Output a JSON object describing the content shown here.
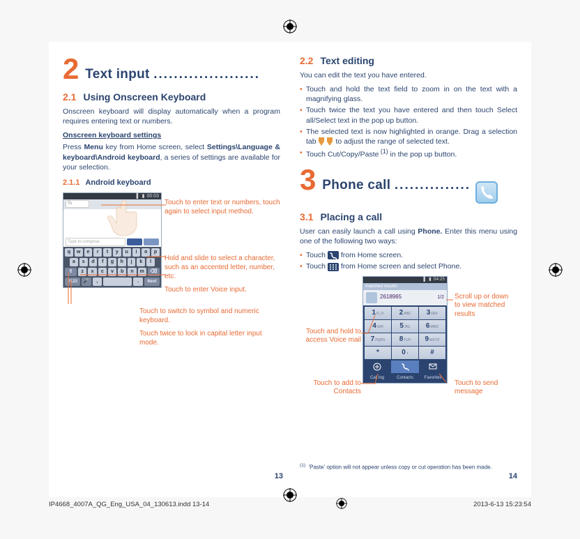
{
  "left": {
    "chapter_num": "2",
    "chapter_title": "Text input",
    "chapter_dots": ".....................",
    "h21_num": "2.1",
    "h21_txt": "Using Onscreen Keyboard",
    "p1": "Onscreen keyboard will display automatically when a program requires entering text or numbers.",
    "kbset_hdr": "Onscreen keyboard settings",
    "p2a": "Press ",
    "p2_menu": "Menu",
    "p2b": " key from Home screen, select ",
    "p2_set": "Settings\\Language & keyboard\\Android keyboard",
    "p2c": ", a series of settings are available for your selection.",
    "h211_num": "2.1.1",
    "h211_txt": "Android keyboard",
    "kb": {
      "time": "00:03",
      "to": "To",
      "compose": "Type to compose",
      "row1": [
        "q",
        "w",
        "e",
        "r",
        "t",
        "y",
        "u",
        "i",
        "o",
        "p"
      ],
      "row2": [
        "a",
        "s",
        "d",
        "f",
        "g",
        "h",
        "j",
        "k",
        "l"
      ],
      "row3_shift": "⇧",
      "row3": [
        "z",
        "x",
        "c",
        "v",
        "b",
        "n",
        "m"
      ],
      "row3_del": "⌫",
      "row4": [
        "?123",
        "🎤",
        ",",
        "space",
        ".",
        "Next"
      ],
      "callout1": "Touch to enter text or numbers, touch again to select input method.",
      "callout2": "Hold and slide to select a character, such as an accented letter, number, etc.",
      "callout3": "Touch to enter Voice input.",
      "callout4": "Touch to switch to symbol and numeric keyboard.",
      "callout5": "Touch twice to lock in capital letter input mode."
    },
    "pg": "13"
  },
  "right": {
    "h22_num": "2.2",
    "h22_txt": "Text editing",
    "p1": "You can edit the text you have entered.",
    "b1": "Touch and hold the text field to zoom in on the text with a magnifying glass.",
    "b2a": "Touch twice the text you have entered and then touch ",
    "b2_bold": "Select all/Select text",
    "b2b": " in the pop up button.",
    "b3a": "The selected text is now highlighted in orange. Drag a selection tab ",
    "b3b": " to adjust the range of selected text.",
    "b4a": "Touch ",
    "b4_bold": "Cut/Copy/Paste",
    "b4_sup": " (1)",
    "b4b": " in the pop up button.",
    "chapter_num": "3",
    "chapter_title": "Phone call",
    "chapter_dots": "...............",
    "h31_num": "3.1",
    "h31_txt": "Placing a call",
    "p2a": "User can easily launch a call using ",
    "p2_phone": "Phone.",
    "p2b": " Enter this menu using one of the following two ways:",
    "pb1a": "Touch ",
    "pb1b": " from Home screen.",
    "pb2a": "Touch ",
    "pb2b": " from Home screen and select ",
    "pb2_phone": "Phone.",
    "dialer": {
      "time": "04:25",
      "tabtitle": "matched results",
      "num_display": "2618965",
      "mini": "1/2",
      "keys": [
        [
          "1",
          "2 ABC",
          "3 DEF"
        ],
        [
          "4 GHI",
          "5 JKL",
          "6 MNO"
        ],
        [
          "7 PQRS",
          "8 TUV",
          "9 WXYZ"
        ],
        [
          "*",
          "0 +",
          "#"
        ]
      ],
      "tabs": [
        "Call log",
        "Contacts",
        "Favorites"
      ],
      "c_right1": "Scroll up or down to view matched results",
      "c_left1": "Touch and hold to access Voice mail",
      "c_left2": "Touch to add to Contacts",
      "c_right2": "Touch to send message"
    },
    "footnote_sup": "(1)",
    "footnote_txt": "'Paste' option will not appear unless copy or cut operation has been made.",
    "pg": "14"
  },
  "footer": {
    "left": "IP4668_4007A_QG_Eng_USA_04_130613.indd   13-14",
    "right": "2013-6-13   15:23:54"
  }
}
